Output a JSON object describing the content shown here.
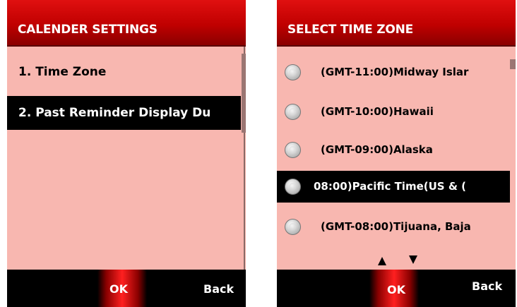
{
  "left_screen": {
    "title": "CALENDER SETTINGS",
    "items": [
      {
        "label": "1. Time Zone",
        "selected": false
      },
      {
        "label": "2. Past Reminder Display Du",
        "selected": true
      }
    ],
    "softkeys": {
      "ok": "OK",
      "back": "Back"
    }
  },
  "right_screen": {
    "title": "SELECT TIME ZONE",
    "items": [
      {
        "label": "(GMT-11:00)Midway Islar",
        "selected": false
      },
      {
        "label": "(GMT-10:00)Hawaii",
        "selected": false
      },
      {
        "label": "(GMT-09:00)Alaska",
        "selected": false
      },
      {
        "label": "08:00)Pacific Time(US & (",
        "selected": true
      },
      {
        "label": "(GMT-08:00)Tijuana, Baja",
        "selected": false
      }
    ],
    "softkeys": {
      "ok": "OK",
      "back": "Back"
    }
  },
  "colors": {
    "background": "#f8b7b0",
    "titlebar": "#c00000",
    "highlight": "#000000",
    "accent_glow": "#ff2020"
  },
  "icons": [
    "radio-button-icon",
    "scroll-up-arrow-icon",
    "scroll-down-arrow-icon"
  ]
}
